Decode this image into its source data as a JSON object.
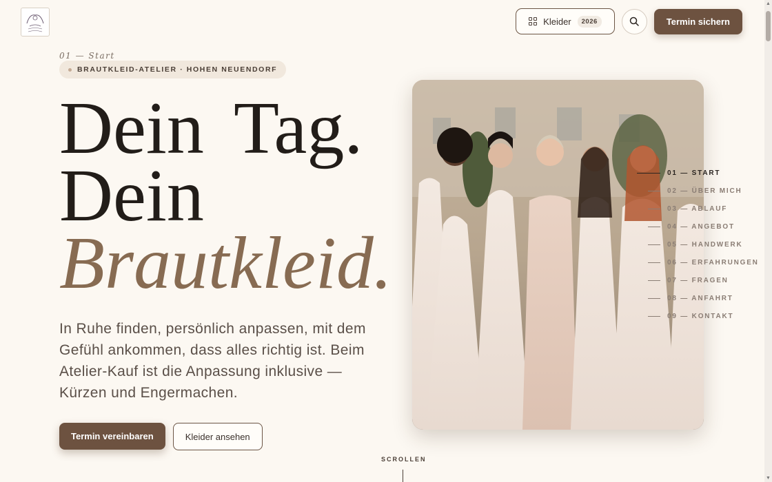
{
  "header": {
    "logo_name": "logo-illustration",
    "kleider_label": "Kleider",
    "kleider_badge": "2026",
    "search_icon": "search-icon",
    "cta_label": "Termin sichern"
  },
  "hero": {
    "section_label": "01 — Start",
    "eyebrow": "BRAUTKLEID-ATELIER · HOHEN NEUENDORF",
    "headline_line1": "Dein Tag.",
    "headline_line2": "Dein",
    "headline_line3": "Brautkleid.",
    "lead": "In Ruhe finden, persönlich anpassen, mit dem Gefühl ankommen, dass alles richtig ist. Beim Atelier-Kauf ist die Anpassung inklusive — Kürzen und Engermachen.",
    "primary_cta": "Termin vereinbaren",
    "secondary_cta": "Kleider ansehen",
    "scroll_label": "SCROLLEN",
    "image_icon": "bridal-group-photo"
  },
  "side_nav": [
    {
      "label": "01 — START",
      "active": true
    },
    {
      "label": "02 — ÜBER MICH",
      "active": false
    },
    {
      "label": "03 — ABLAUF",
      "active": false
    },
    {
      "label": "04 — ANGEBOT",
      "active": false
    },
    {
      "label": "05 — HANDWERK",
      "active": false
    },
    {
      "label": "06 — ERFAHRUNGEN",
      "active": false
    },
    {
      "label": "07 — FRAGEN",
      "active": false
    },
    {
      "label": "08 — ANFAHRT",
      "active": false
    },
    {
      "label": "09 — KONTAKT",
      "active": false
    }
  ],
  "colors": {
    "accent": "#6d5240",
    "headline_accent": "#876b52",
    "background": "#fcf8f2"
  }
}
